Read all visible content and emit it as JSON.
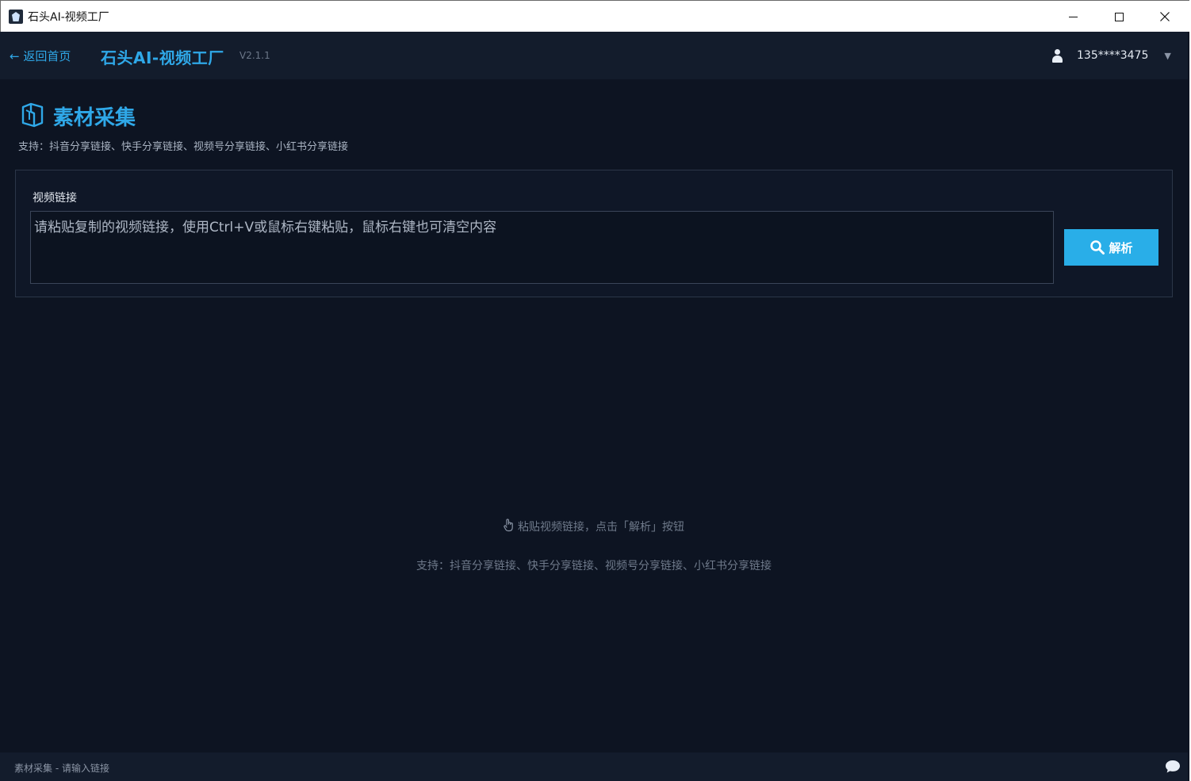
{
  "window": {
    "title": "石头AI-视频工厂"
  },
  "header": {
    "back_label": "← 返回首页",
    "app_name": "石头AI-视频工厂",
    "version": "V2.1.1",
    "user_phone": "135****3475",
    "user_caret": "▼"
  },
  "section": {
    "title": "素材采集",
    "subtitle": "支持：抖音分享链接、快手分享链接、视频号分享链接、小红书分享链接"
  },
  "input_panel": {
    "label": "视频链接",
    "placeholder": "请粘贴复制的视频链接，使用Ctrl+V或鼠标右键粘贴，鼠标右键也可清空内容",
    "value": "",
    "parse_button": "解析"
  },
  "empty_state": {
    "hint": "粘贴视频链接，点击「解析」按钮",
    "support": "支持：抖音分享链接、快手分享链接、视频号分享链接、小红书分享链接"
  },
  "status_bar": {
    "text": "素材采集 - 请输入链接"
  },
  "colors": {
    "accent": "#2fa8e8",
    "button": "#29aee8",
    "background": "#0d1422",
    "header": "#131c2c"
  },
  "icons": {
    "app": "app-logo-icon",
    "user": "user-icon",
    "section": "material-box-icon",
    "search": "search-icon",
    "hand": "pointer-hand-icon",
    "chat": "chat-bubble-icon"
  }
}
